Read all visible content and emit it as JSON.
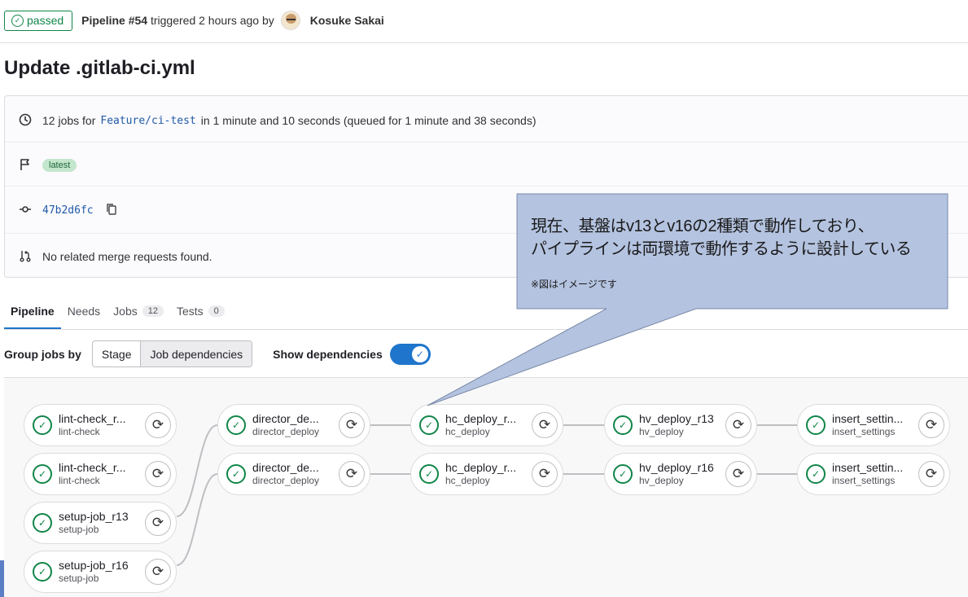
{
  "header": {
    "status": "passed",
    "pipeline": "Pipeline #54",
    "triggered": "triggered 2 hours ago by",
    "author": "Kosuke Sakai"
  },
  "title": "Update .gitlab-ci.yml",
  "info": {
    "jobs_prefix": "12 jobs for",
    "branch": "Feature/ci-test",
    "jobs_suffix": "in 1 minute and 10 seconds (queued for 1 minute and 38 seconds)",
    "latest_badge": "latest",
    "commit_sha": "47b2d6fc",
    "merge_requests": "No related merge requests found."
  },
  "tabs": [
    {
      "label": "Pipeline"
    },
    {
      "label": "Needs"
    },
    {
      "label": "Jobs",
      "count": "12"
    },
    {
      "label": "Tests",
      "count": "0"
    }
  ],
  "group": {
    "label": "Group jobs by",
    "stage": "Stage",
    "job_dependencies": "Job dependencies",
    "show_dependencies": "Show dependencies",
    "show_dependencies_on": true
  },
  "jobs": [
    {
      "name": "lint-check_r...",
      "stage": "lint-check"
    },
    {
      "name": "lint-check_r...",
      "stage": "lint-check"
    },
    {
      "name": "setup-job_r13",
      "stage": "setup-job"
    },
    {
      "name": "setup-job_r16",
      "stage": "setup-job"
    },
    {
      "name": "director_de...",
      "stage": "director_deploy"
    },
    {
      "name": "director_de...",
      "stage": "director_deploy"
    },
    {
      "name": "hc_deploy_r...",
      "stage": "hc_deploy"
    },
    {
      "name": "hc_deploy_r...",
      "stage": "hc_deploy"
    },
    {
      "name": "hv_deploy_r13",
      "stage": "hv_deploy"
    },
    {
      "name": "hv_deploy_r16",
      "stage": "hv_deploy"
    },
    {
      "name": "insert_settin...",
      "stage": "insert_settings"
    },
    {
      "name": "insert_settin...",
      "stage": "insert_settings"
    }
  ],
  "callout": {
    "line1": "現在、基盤はv13とv16の2種類で動作しており、",
    "line2": "パイプラインは両環境で動作するように設計している",
    "note": "※図はイメージです"
  },
  "colors": {
    "success": "#108548",
    "accent": "#1f75cb",
    "callout_fill": "#b4c3e0"
  }
}
